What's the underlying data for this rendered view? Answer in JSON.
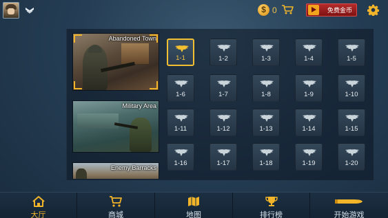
{
  "topbar": {
    "avatar_icon": "player-avatar",
    "rank_icon": "chevron-rank-icon",
    "coin_symbol": "$",
    "coin_count": "0",
    "cart_icon": "cart-icon",
    "free_coins_label": "免费金币",
    "settings_icon": "gear-icon"
  },
  "maps": [
    {
      "name": "Abandoned Town",
      "selected": true
    },
    {
      "name": "Military Area",
      "selected": false
    },
    {
      "name": "Enemy Barracks",
      "selected": false
    }
  ],
  "levels": [
    [
      "1-1",
      "1-2",
      "1-3",
      "1-4",
      "1-5"
    ],
    [
      "1-6",
      "1-7",
      "1-8",
      "1-9",
      "1-10"
    ],
    [
      "1-11",
      "1-12",
      "1-13",
      "1-14",
      "1-15"
    ],
    [
      "1-16",
      "1-17",
      "1-18",
      "1-19",
      "1-20"
    ]
  ],
  "active_level": "1-1",
  "nav": [
    {
      "label": "大厅",
      "icon": "home-icon",
      "active": true
    },
    {
      "label": "商城",
      "icon": "cart-icon",
      "active": false
    },
    {
      "label": "地图",
      "icon": "map-icon",
      "active": false
    },
    {
      "label": "排行榜",
      "icon": "trophy-icon",
      "active": false
    },
    {
      "label": "开始游戏",
      "icon": "bullet-icon",
      "active": false
    }
  ],
  "colors": {
    "accent": "#f2b52a",
    "ad_button": "#b42b2b",
    "tile": "#34485a"
  }
}
